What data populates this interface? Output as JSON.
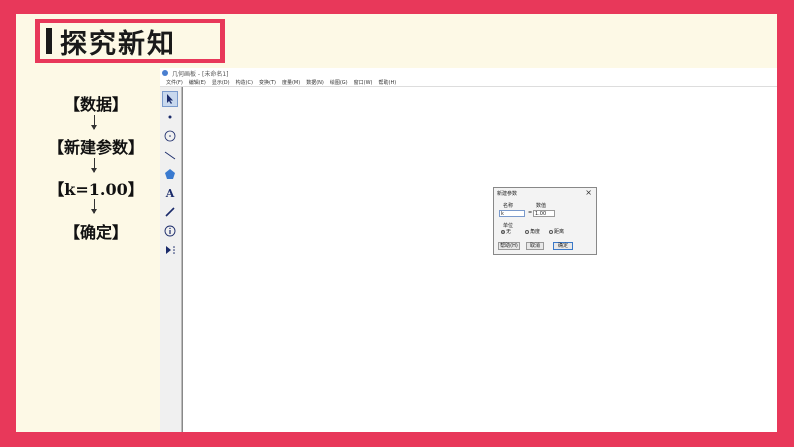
{
  "slide": {
    "title": "探究新知"
  },
  "steps": [
    "【数据】",
    "【新建参数】",
    "【k=1.00】",
    "【确定】"
  ],
  "app": {
    "title": "几何画板 - [未命名1]",
    "menu": [
      "文件(F)",
      "编辑(E)",
      "显示(D)",
      "构造(C)",
      "变换(T)",
      "度量(M)",
      "数据(N)",
      "绘图(G)",
      "窗口(W)",
      "帮助(H)"
    ],
    "tools": [
      "select-arrow-tool",
      "point-tool",
      "compass-tool",
      "line-tool",
      "polygon-tool",
      "text-tool",
      "marker-tool",
      "info-tool",
      "custom-tool"
    ]
  },
  "dialog": {
    "title": "新建参数",
    "name_label": "名称",
    "value_label": "数值",
    "name_value": "k",
    "equals": "=",
    "value_value": "1.00",
    "unit_label": "单位",
    "units": [
      "无",
      "角度",
      "距离"
    ],
    "selected_unit": "无",
    "help_label": "帮助(H)",
    "cancel_label": "取消",
    "ok_label": "确定"
  },
  "colors": {
    "frame": "#e8385a",
    "background": "#fdf9e6"
  }
}
